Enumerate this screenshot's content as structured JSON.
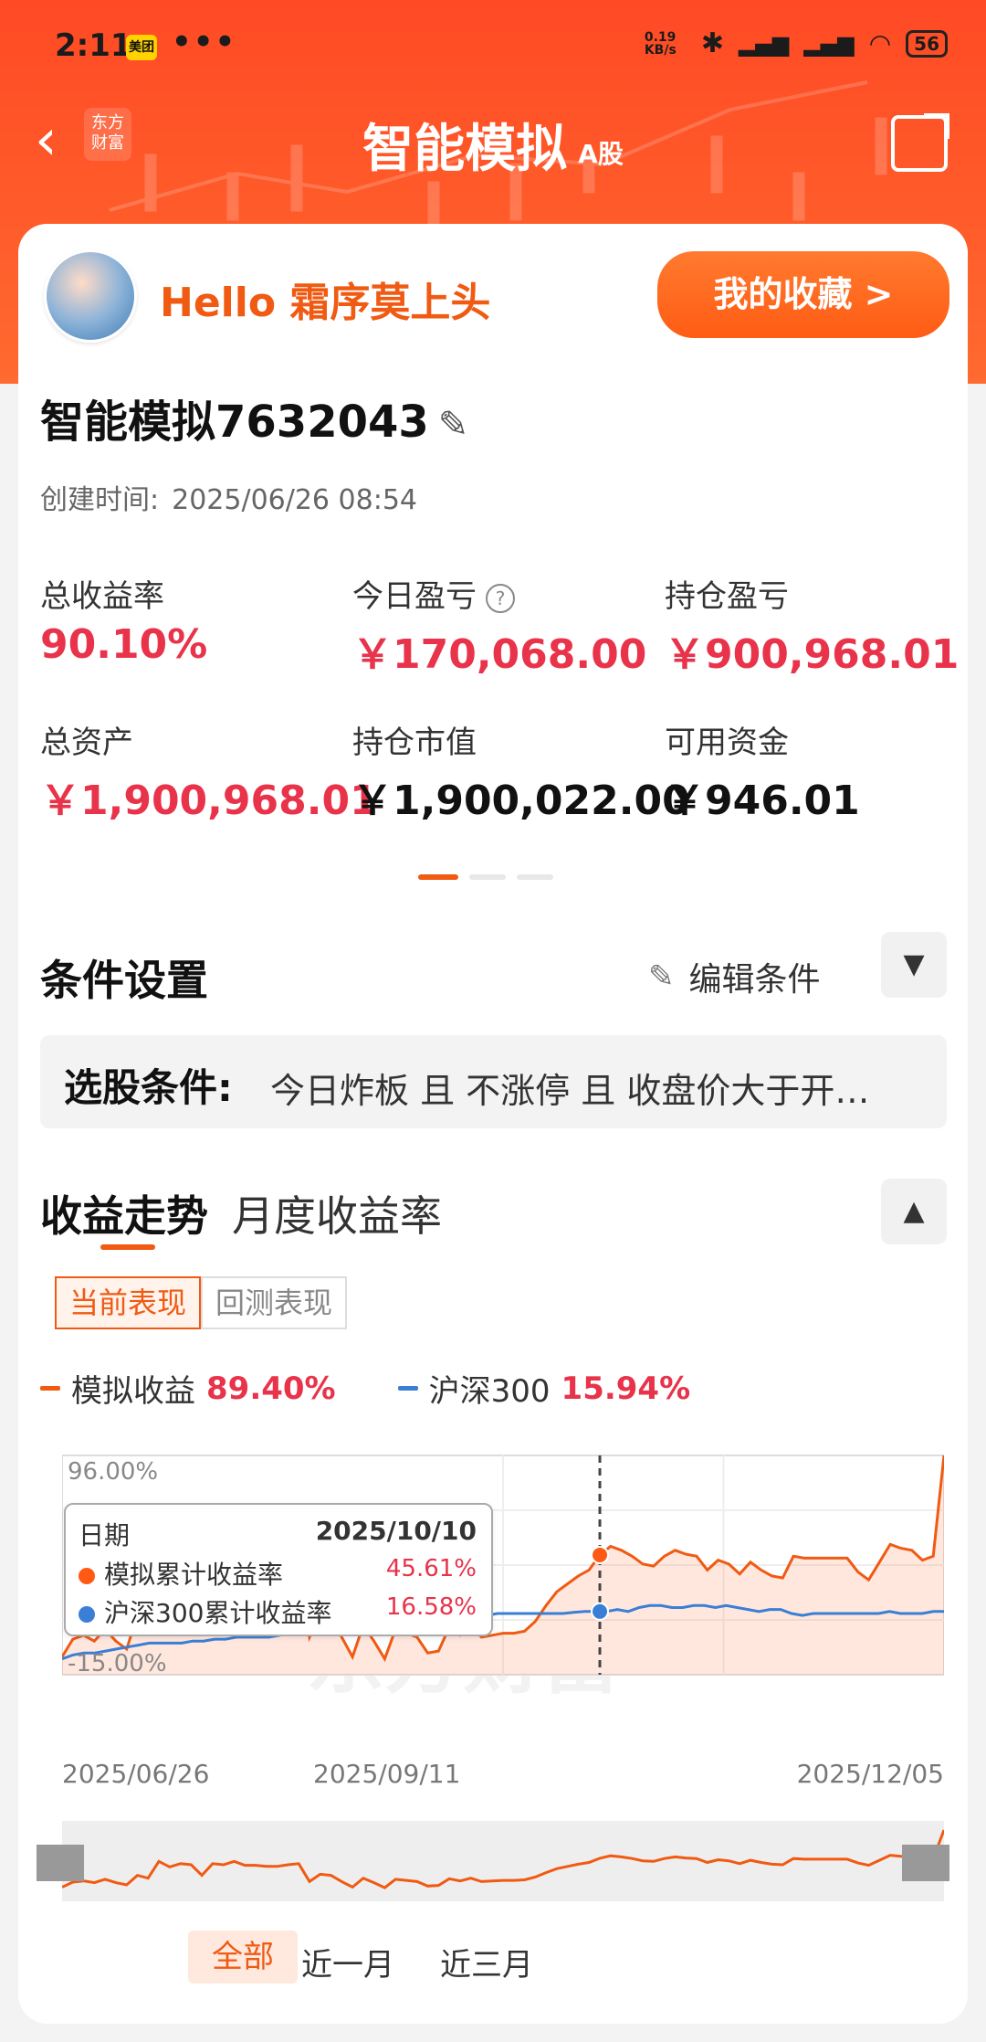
{
  "status": {
    "time": "2:11",
    "app_badge": "美团",
    "dots": "•••",
    "speed": "0.19 KB/s",
    "battery": "56"
  },
  "nav": {
    "logo_text": "东方 财富",
    "title": "智能模拟",
    "title_sub": "A股"
  },
  "user": {
    "greeting": "Hello 霜序莫上头",
    "favorites_button": "我的收藏 >"
  },
  "account": {
    "name": "智能模拟7632043",
    "created_label": "创建时间:",
    "created_value": "2025/06/26 08:54"
  },
  "metrics": [
    {
      "label": "总收益率",
      "value": "90.10%",
      "color": "#e8334a"
    },
    {
      "label": "今日盈亏",
      "value": "￥170,068.00",
      "color": "#e8334a"
    },
    {
      "label": "持仓盈亏",
      "value": "￥900,968.01",
      "color": "#e8334a"
    },
    {
      "label": "总资产",
      "value": "￥1,900,968.01",
      "color": "#e8334a"
    },
    {
      "label": "持仓市值",
      "value": "￥1,900,022.00",
      "color": "#111111"
    },
    {
      "label": "可用资金",
      "value": "￥946.01",
      "color": "#111111"
    }
  ],
  "conditions": {
    "section_title": "条件设置",
    "edit_label": "编辑条件",
    "label": "选股条件:",
    "value": "今日炸板 且 不涨停 且 收盘价大于开…"
  },
  "performance": {
    "tab_active": "收益走势",
    "tab_other": "月度收益率",
    "mode_active": "当前表现",
    "mode_other": "回测表现",
    "legend": [
      {
        "name": "模拟收益",
        "value": "89.40%",
        "color": "#f05a12"
      },
      {
        "name": "沪深300",
        "value": "15.94%",
        "color": "#3a7fd5"
      }
    ],
    "tooltip": {
      "date_label": "日期",
      "date": "2025/10/10",
      "rows": [
        {
          "name": "模拟累计收益率",
          "value": "45.61%",
          "color": "#ff5a14"
        },
        {
          "name": "沪深300累计收益率",
          "value": "16.58%",
          "color": "#3a7fd5"
        }
      ]
    },
    "watermark": "东方财富",
    "ranges": [
      "全部",
      "近一月",
      "近三月"
    ]
  },
  "chart_data": {
    "type": "area",
    "ylim": [
      -15.0,
      96.0
    ],
    "y_tick_labels": [
      "96.00%",
      "-15.00%"
    ],
    "x_tick_labels": [
      "2025/06/26",
      "2025/09/11",
      "2025/12/05"
    ],
    "series": [
      {
        "name": "模拟收益",
        "values": [
          -6,
          3,
          5,
          2,
          8,
          2,
          -2,
          15,
          10,
          40,
          30,
          36,
          34,
          15,
          36,
          34,
          40,
          33,
          33,
          31,
          31,
          34,
          36,
          4,
          17,
          15,
          4,
          -6,
          10,
          2,
          -7,
          8,
          6,
          4,
          -4,
          -3,
          9,
          5,
          10,
          4,
          5,
          6,
          6,
          7,
          12,
          20,
          27,
          31,
          35,
          38,
          45.61,
          50,
          48,
          45,
          41,
          40,
          45,
          48,
          46,
          45,
          38,
          43,
          41,
          36,
          42,
          38,
          35,
          34,
          45,
          44,
          44,
          44,
          44,
          44,
          37,
          33,
          42,
          51,
          49,
          48,
          43,
          45,
          96
        ]
      },
      {
        "name": "沪深300",
        "values": [
          -7,
          -5,
          -4,
          -4,
          -3,
          -2,
          -1,
          0,
          1,
          1,
          1,
          1,
          2,
          2,
          3,
          3,
          4,
          4,
          4,
          4,
          5,
          6,
          6,
          7,
          7,
          8,
          9,
          9,
          10,
          11,
          12,
          12,
          12,
          13,
          14,
          14,
          14,
          15,
          15,
          15,
          16,
          16,
          16,
          16,
          16,
          16,
          16,
          16.58,
          17,
          17,
          17,
          18,
          17,
          19,
          20,
          20,
          19,
          19,
          20,
          20,
          19,
          20,
          19,
          18,
          17,
          18,
          18,
          16,
          15,
          16,
          16,
          16,
          16,
          16,
          16,
          16,
          17,
          16,
          16,
          16,
          17,
          17
        ]
      }
    ],
    "highlight_x_index": 50
  }
}
